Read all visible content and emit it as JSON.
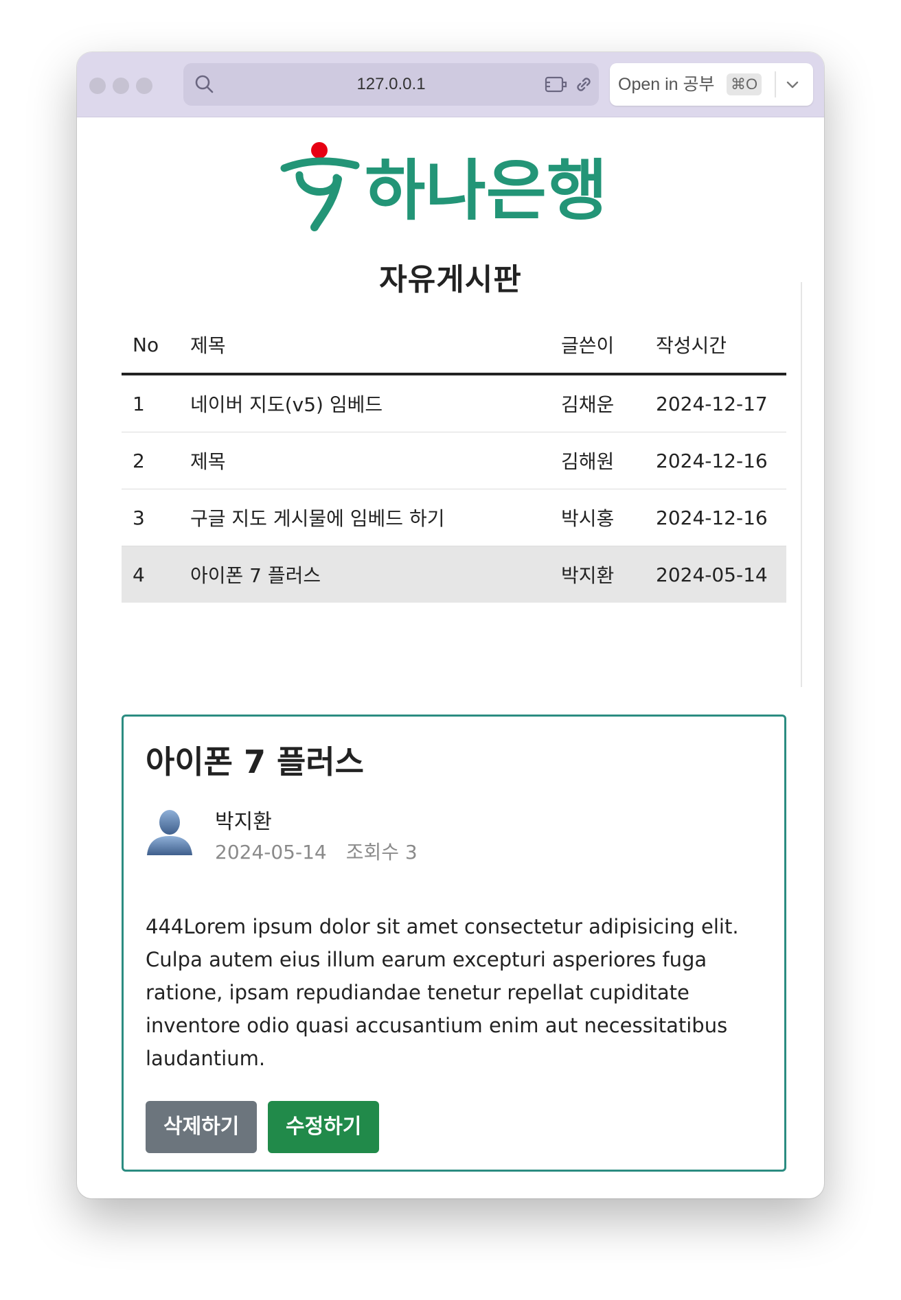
{
  "browser": {
    "url": "127.0.0.1",
    "open_in_label": "Open in 공부",
    "open_in_shortcut": "⌘O"
  },
  "brand": {
    "name": "하나은행",
    "primary_color": "#239577",
    "accent_color": "#e60012"
  },
  "board": {
    "title": "자유게시판",
    "columns": [
      "No",
      "제목",
      "글쓴이",
      "작성시간"
    ],
    "rows": [
      {
        "no": "1",
        "title": "네이버 지도(v5) 임베드",
        "author": "김채운",
        "date": "2024-12-17"
      },
      {
        "no": "2",
        "title": "제목",
        "author": "김해원",
        "date": "2024-12-16"
      },
      {
        "no": "3",
        "title": "구글 지도 게시물에 임베드 하기",
        "author": "박시홍",
        "date": "2024-12-16"
      },
      {
        "no": "4",
        "title": "아이폰 7 플러스",
        "author": "박지환",
        "date": "2024-05-14"
      }
    ]
  },
  "post": {
    "title": "아이폰 7 플러스",
    "author": "박지환",
    "date": "2024-05-14",
    "views": "조회수 3",
    "body": "444Lorem ipsum dolor sit amet consectetur adipisicing elit. Culpa autem eius illum earum excepturi asperiores fuga ratione, ipsam repudiandae tenetur repellat cupiditate inventore odio quasi accusantium enim aut necessitatibus laudantium.",
    "delete_label": "삭제하기",
    "edit_label": "수정하기"
  }
}
